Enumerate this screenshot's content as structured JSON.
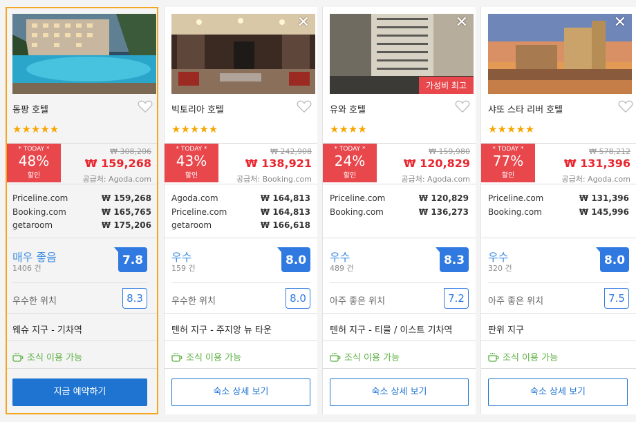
{
  "hotels": [
    {
      "name": "동팡 호텔",
      "stars": "★★★★★",
      "today": "* TODAY *",
      "discount": "48%",
      "discount_label": "할인",
      "old_price": "₩ 308,206",
      "new_price": "₩ 159,268",
      "supplier": "공급처: Agoda.com",
      "prices": [
        {
          "site": "Priceline.com",
          "price": "₩ 159,268"
        },
        {
          "site": "Booking.com",
          "price": "₩ 165,765"
        },
        {
          "site": "getaroom",
          "price": "₩ 175,206"
        }
      ],
      "rating_label": "매우 좋음",
      "reviews": "1406 건",
      "score": "7.8",
      "location_label": "우수한 위치",
      "location_score": "8.3",
      "district": "웨슈 지구 - 기차역",
      "breakfast": "조식 이용 가능",
      "button": "지금 예약하기"
    },
    {
      "name": "빅토리아 호텔",
      "stars": "★★★★★",
      "today": "* TODAY *",
      "discount": "43%",
      "discount_label": "할인",
      "old_price": "₩ 242,908",
      "new_price": "₩ 138,921",
      "supplier": "공급처: Booking.com",
      "prices": [
        {
          "site": "Agoda.com",
          "price": "₩ 164,813"
        },
        {
          "site": "Priceline.com",
          "price": "₩ 164,813"
        },
        {
          "site": "getaroom",
          "price": "₩ 166,618"
        }
      ],
      "rating_label": "우수",
      "reviews": "159 건",
      "score": "8.0",
      "location_label": "우수한 위치",
      "location_score": "8.0",
      "district": "텐허 지구 - 주지앙 뉴 타운",
      "breakfast": "조식 이용 가능",
      "button": "숙소 상세 보기"
    },
    {
      "name": "유와 호텔",
      "stars": "★★★★",
      "tag": "가성비 최고",
      "today": "* TODAY *",
      "discount": "24%",
      "discount_label": "할인",
      "old_price": "₩ 159,980",
      "new_price": "₩ 120,829",
      "supplier": "공급처: Agoda.com",
      "prices": [
        {
          "site": "Priceline.com",
          "price": "₩ 120,829"
        },
        {
          "site": "Booking.com",
          "price": "₩ 136,273"
        }
      ],
      "rating_label": "우수",
      "reviews": "489 건",
      "score": "8.3",
      "location_label": "아주 좋은 위치",
      "location_score": "7.2",
      "district": "텐허 지구 - 티믈 / 이스트 기차역",
      "breakfast": "조식 이용 가능",
      "button": "숙소 상세 보기"
    },
    {
      "name": "샤또 스타 리버 호텔",
      "stars": "★★★★★",
      "today": "* TODAY *",
      "discount": "77%",
      "discount_label": "할인",
      "old_price": "₩ 578,212",
      "new_price": "₩ 131,396",
      "supplier": "공급처: Agoda.com",
      "prices": [
        {
          "site": "Priceline.com",
          "price": "₩ 131,396"
        },
        {
          "site": "Booking.com",
          "price": "₩ 145,996"
        }
      ],
      "rating_label": "우수",
      "reviews": "320 건",
      "score": "8.0",
      "location_label": "아주 좋은 위치",
      "location_score": "7.5",
      "district": "판위 지구",
      "breakfast": "조식 이용 가능",
      "button": "숙소 상세 보기"
    }
  ],
  "colors": {
    "accent": "#1f74d1",
    "deal": "#e8474c",
    "price": "#e8262e",
    "selected_border": "#f5a623",
    "star": "#f7a600",
    "breakfast": "#5cb043"
  }
}
